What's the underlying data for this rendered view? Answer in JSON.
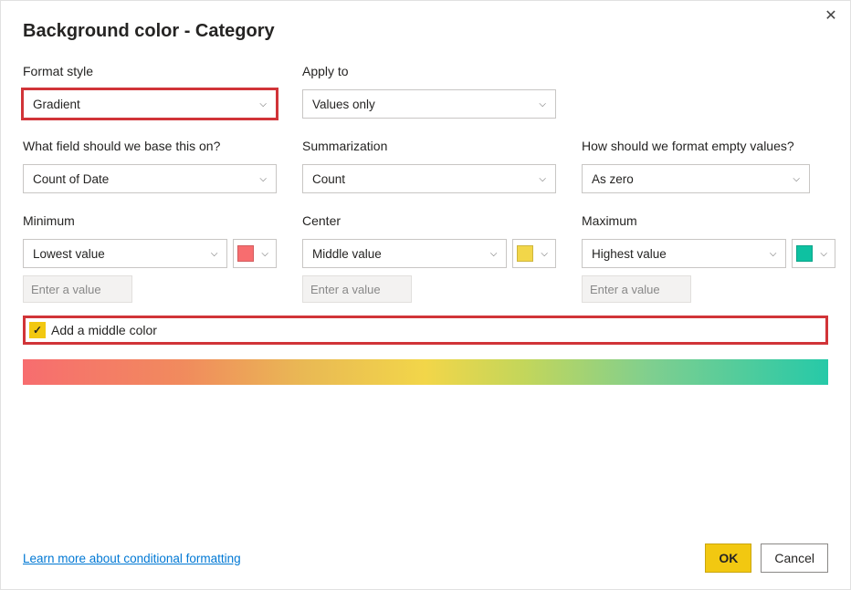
{
  "dialog": {
    "title": "Background color - Category",
    "close_icon": "✕"
  },
  "formatStyle": {
    "label": "Format style",
    "value": "Gradient"
  },
  "applyTo": {
    "label": "Apply to",
    "value": "Values only"
  },
  "baseField": {
    "label": "What field should we base this on?",
    "value": "Count of Date"
  },
  "summarization": {
    "label": "Summarization",
    "value": "Count"
  },
  "emptyValues": {
    "label": "How should we format empty values?",
    "value": "As zero"
  },
  "minimum": {
    "label": "Minimum",
    "typeValue": "Lowest value",
    "placeholder": "Enter a value",
    "color": "#f76d6f"
  },
  "center": {
    "label": "Center",
    "typeValue": "Middle value",
    "placeholder": "Enter a value",
    "color": "#f2d649"
  },
  "maximum": {
    "label": "Maximum",
    "typeValue": "Highest value",
    "placeholder": "Enter a value",
    "color": "#0ec1a1"
  },
  "middleColor": {
    "label": "Add a middle color",
    "checked": true
  },
  "footer": {
    "learnMore": "Learn more about conditional formatting",
    "ok": "OK",
    "cancel": "Cancel"
  }
}
